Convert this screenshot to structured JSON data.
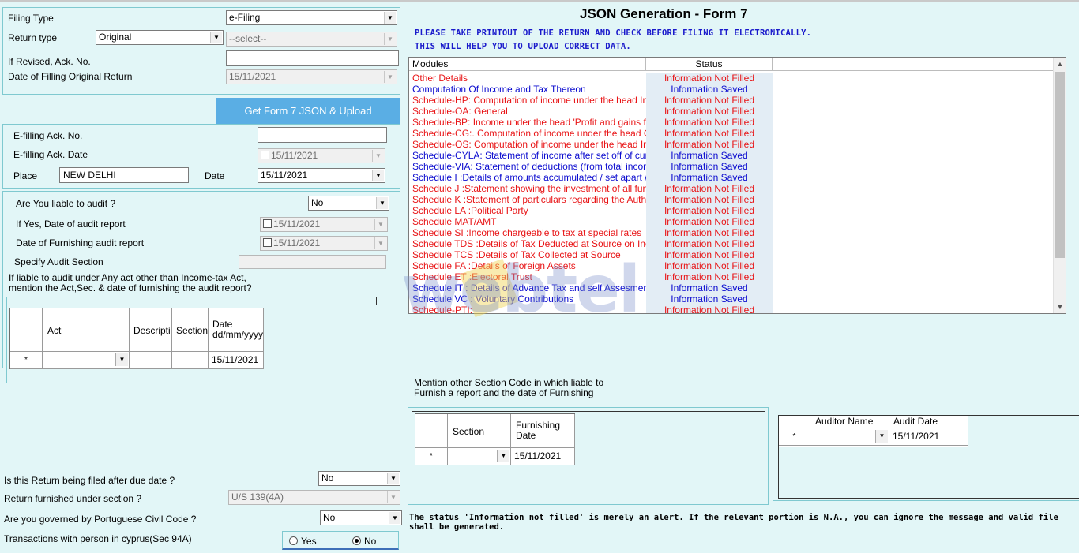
{
  "filing": {
    "filing_type_label": "Filing Type",
    "filing_type_value": "e-Filing",
    "return_type_label": "Return type",
    "return_type_value": "Original",
    "return_type_select": "--select--",
    "revised_ack_label": "If Revised, Ack. No.",
    "revised_ack_value": "",
    "date_original_label": "Date of Filling Original Return",
    "date_original_value": "15/11/2021"
  },
  "upload_button": "Get Form 7 JSON & Upload",
  "efiling": {
    "ack_no_label": "E-filling Ack. No.",
    "ack_no_value": "",
    "ack_date_label": "E-filling Ack.  Date",
    "ack_date_value": "15/11/2021",
    "place_label": "Place",
    "place_value": "NEW DELHI",
    "date_label": "Date",
    "date_value": "15/11/2021"
  },
  "audit": {
    "liable_label": "Are You liable to audit ?",
    "liable_value": "No",
    "date_report_label": "If Yes, Date of audit report",
    "date_report_value": "15/11/2021",
    "furnish_label": "Date of Furnishing audit report",
    "furnish_value": "15/11/2021",
    "section_label": "Specify Audit Section",
    "section_value": "",
    "other_act_line1": "If liable to audit under Any act other than Income-tax Act,",
    "other_act_line2": "mention the Act,Sec. & date of furnishing the audit report?",
    "grid_headers": [
      "Act",
      "Descriptio",
      "Section",
      "Date dd/mm/yyyy"
    ],
    "grid_row_marker": "*",
    "grid_row_date": "15/11/2021"
  },
  "bottom_left": {
    "due_date_label": "Is this Return being filed after due date ?",
    "due_date_value": "No",
    "section_label": "Return furnished under section ?",
    "section_value": "U/S 139(4A)",
    "portuguese_label": "Are you governed by Portuguese Civil Code ?",
    "portuguese_value": "No",
    "cyprus_label": "Transactions with person in cyprus(Sec 94A)",
    "yes_label": "Yes",
    "no_label": "No",
    "selected": "No"
  },
  "header": {
    "title": "JSON Generation  - Form 7",
    "warn1": "PLEASE TAKE PRINTOUT OF THE RETURN AND CHECK BEFORE FILING IT ELECTRONICALLY.",
    "warn2": "THIS WILL HELP YOU TO UPLOAD CORRECT DATA."
  },
  "modules": {
    "col_modules": "Modules",
    "col_status": "Status",
    "rows": [
      {
        "name": "Other Details",
        "status": "Information Not Filled",
        "color": "red"
      },
      {
        "name": "Computation Of Income and Tax Thereon",
        "status": "Information Saved",
        "color": "blue"
      },
      {
        "name": "Schedule-HP: Computation of income under the head Incom...",
        "status": "Information Not Filled",
        "color": "red"
      },
      {
        "name": "Schedule-OA: General",
        "status": "Information Not Filled",
        "color": "red"
      },
      {
        "name": "Schedule-BP: Income under the head 'Profit and gains from ...",
        "status": "Information Not Filled",
        "color": "red"
      },
      {
        "name": "Schedule-CG:. Computation of income under the head Capit...",
        "status": "Information Not Filled",
        "color": "red"
      },
      {
        "name": "Schedule-OS: Computation of income under the head Incom...",
        "status": "Information Not Filled",
        "color": "red"
      },
      {
        "name": "Schedule-CYLA: Statement of income after set off of current ...",
        "status": "Information Saved",
        "color": "blue"
      },
      {
        "name": "Schedule-VIA: Statement of deductions (from total income) u...",
        "status": "Information Saved",
        "color": "blue"
      },
      {
        "name": "Schedule I :Details of amounts accumulated / set apart withi...",
        "status": "Information Saved",
        "color": "blue"
      },
      {
        "name": "Schedule J :Statement showing the investment of all funds a...",
        "status": "Information Not Filled",
        "color": "red"
      },
      {
        "name": "Schedule K :Statement of particulars regarding the Author(s) ...",
        "status": "Information Not Filled",
        "color": "red"
      },
      {
        "name": "Schedule LA :Political Party",
        "status": "Information Not Filled",
        "color": "red"
      },
      {
        "name": "Schedule MAT/AMT",
        "status": "Information Not Filled",
        "color": "red"
      },
      {
        "name": "Schedule SI :Income chargeable to tax at special rates",
        "status": "Information Not Filled",
        "color": "red"
      },
      {
        "name": "Schedule TDS :Details of Tax Deducted at Source on Income",
        "status": "Information Not Filled",
        "color": "red"
      },
      {
        "name": "Schedule TCS :Details of Tax Collected at Source",
        "status": "Information Not Filled",
        "color": "red"
      },
      {
        "name": "Schedule FA :Details of Foreign Assets",
        "status": "Information Not Filled",
        "color": "red"
      },
      {
        "name": "Schedule ET :Electoral Trust",
        "status": "Information Not Filled",
        "color": "red"
      },
      {
        "name": "Schedule IT : Details of Advance Tax and self Assesment Tax",
        "status": "Information Saved",
        "color": "blue"
      },
      {
        "name": "Schedule VC : Voluntary Contributions",
        "status": "Information Saved",
        "color": "blue"
      },
      {
        "name": "Schedule-PTI:",
        "status": "Information Not Filled",
        "color": "red"
      }
    ]
  },
  "other_section": {
    "line1": "Mention other Section Code in which liable to",
    "line2": "Furnish a report and the date of Furnishing",
    "col_section": "Section",
    "col_date": "Furnishing Date",
    "row_marker": "*",
    "row_date": "15/11/2021"
  },
  "auditor": {
    "col_name": "Auditor Name",
    "col_date": "Audit Date",
    "row_marker": "*",
    "row_date": "15/11/2021"
  },
  "note": "The status 'Information not filled' is merely an alert. If the relevant portion is N.A., you can ignore the message and valid file shall be generated.",
  "watermark": "webtel",
  "colors": {
    "red": "#e81416",
    "blue": "#0b0bcf",
    "button": "#5aaee4",
    "background": "#e2f6f7"
  }
}
